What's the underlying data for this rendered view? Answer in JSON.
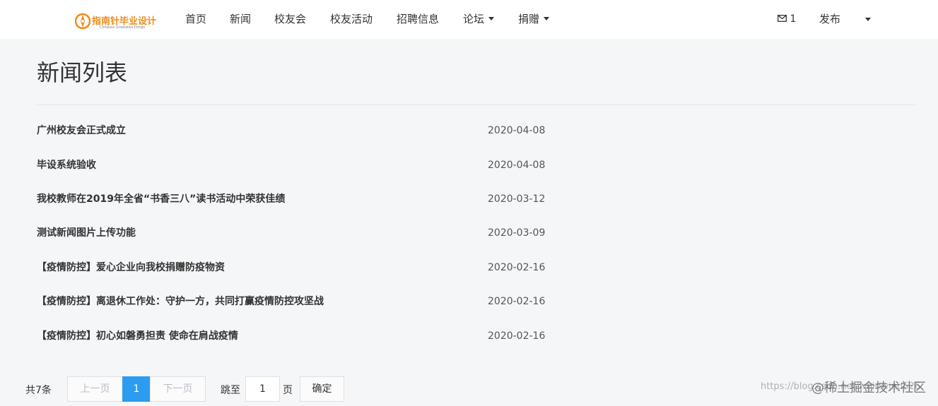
{
  "brand": {
    "name": "指南针毕业设计",
    "subtitle": "Compass Graduation Design",
    "color": "#f08c1c"
  },
  "nav": {
    "items": [
      {
        "label": "首页",
        "dropdown": false
      },
      {
        "label": "新闻",
        "dropdown": false
      },
      {
        "label": "校友会",
        "dropdown": false
      },
      {
        "label": "校友活动",
        "dropdown": false
      },
      {
        "label": "招聘信息",
        "dropdown": false
      },
      {
        "label": "论坛",
        "dropdown": true
      },
      {
        "label": "捐赠",
        "dropdown": true
      }
    ],
    "messages": {
      "icon": "mail-icon",
      "count": "1"
    },
    "publish_label": "发布"
  },
  "page": {
    "title": "新闻列表"
  },
  "news": [
    {
      "title": "广州校友会正式成立",
      "date": "2020-04-08"
    },
    {
      "title": "毕设系统验收",
      "date": "2020-04-08"
    },
    {
      "title": "我校教师在2019年全省“书香三八”读书活动中荣获佳绩",
      "date": "2020-03-12"
    },
    {
      "title": "测试新闻图片上传功能",
      "date": "2020-03-09"
    },
    {
      "title": "【疫情防控】爱心企业向我校捐赠防疫物资",
      "date": "2020-02-16"
    },
    {
      "title": "【疫情防控】离退休工作处：守护一方，共同打赢疫情防控攻坚战",
      "date": "2020-02-16"
    },
    {
      "title": "【疫情防控】初心如磐勇担责 使命在肩战疫情",
      "date": "2020-02-16"
    }
  ],
  "pagination": {
    "total_text": "共7条",
    "prev_label": "上一页",
    "current_page": "1",
    "next_label": "下一页",
    "jump_prefix": "跳至",
    "jump_value": "1",
    "jump_suffix": "页",
    "confirm_label": "确定",
    "accent_color": "#2d9cf0"
  },
  "watermark": {
    "url": "https://blog.csdn.net/whirlwind526",
    "text": "@稀土掘金技术社区"
  }
}
